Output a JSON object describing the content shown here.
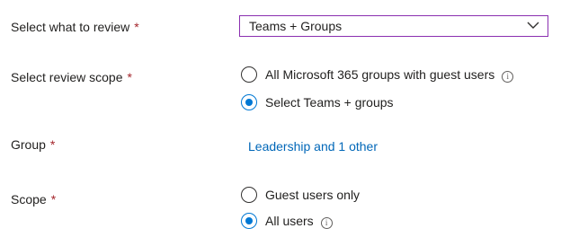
{
  "review_target": {
    "label": "Select what to review",
    "required_mark": "*",
    "selected_value": "Teams + Groups",
    "icon": "chevron-down-icon"
  },
  "review_scope": {
    "label": "Select review scope",
    "required_mark": "*",
    "options": [
      {
        "label": "All Microsoft 365 groups with guest users",
        "checked": false,
        "has_info": true
      },
      {
        "label": "Select Teams + groups",
        "checked": true,
        "has_info": false
      }
    ]
  },
  "group": {
    "label": "Group",
    "required_mark": "*",
    "link_text": "Leadership and 1 other"
  },
  "scope": {
    "label": "Scope",
    "required_mark": "*",
    "options": [
      {
        "label": "Guest users only",
        "checked": false,
        "has_info": false
      },
      {
        "label": "All users",
        "checked": true,
        "has_info": true
      }
    ]
  },
  "info_glyph": "i",
  "colors": {
    "accent": "#0078d4",
    "link": "#0067b8",
    "required": "#a4262c",
    "select_border": "#8a2fb0"
  }
}
